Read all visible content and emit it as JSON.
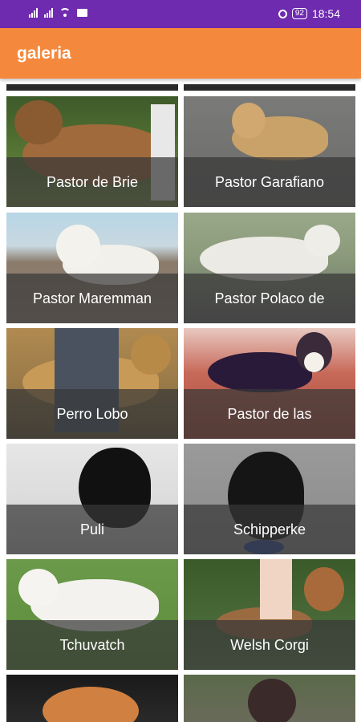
{
  "status_bar": {
    "time": "18:54",
    "battery": "92"
  },
  "app_bar": {
    "title": "galeria"
  },
  "colors": {
    "status_bar": "#6f2bb0",
    "app_bar": "#f4893d",
    "overlay": "rgba(55,55,55,0.72)"
  },
  "gallery": [
    "Pastor de Brie",
    "Pastor Garafiano",
    "Pastor Maremman",
    "Pastor Polaco de",
    "Perro Lobo",
    "Pastor de las",
    "Puli",
    "Schipperke",
    "Tchuvatch",
    "Welsh Corgi"
  ]
}
